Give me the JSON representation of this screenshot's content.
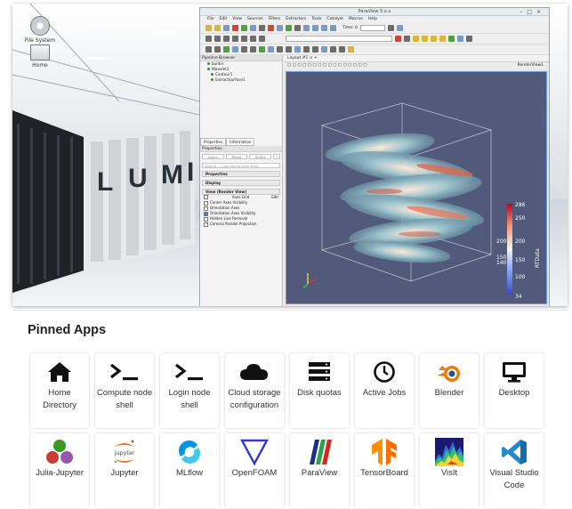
{
  "hero": {
    "desktop_icons": [
      {
        "label": "File System"
      },
      {
        "label": "Home"
      }
    ],
    "paraview": {
      "window_title": "ParaView 5.x.x",
      "menu": [
        "File",
        "Edit",
        "View",
        "Sources",
        "Filters",
        "Extractors",
        "Tools",
        "Catalyst",
        "Macros",
        "Help"
      ],
      "time_label": "Time: 0",
      "pipeline_header": "Pipeline Browser",
      "pipeline_items": [
        "builtin:",
        "Wavelet1",
        "Contour1",
        "ExtractSurface1"
      ],
      "tabs": [
        "Properties",
        "Information"
      ],
      "properties_header": "Properties",
      "buttons": [
        "Apply",
        "Reset",
        "Delete",
        "?"
      ],
      "search_placeholder": "Search ... (use Esc to clear text)",
      "sections": [
        "Properties",
        "Display",
        "View (Render View)"
      ],
      "axes_grid_label": "Axes Grid",
      "axes_grid_edit": "Edit",
      "options": [
        {
          "label": "Center Axes Visibility",
          "checked": false
        },
        {
          "label": "Orientation Axes",
          "checked": false
        },
        {
          "label": "Orientation Axes Visibility",
          "checked": true
        },
        {
          "label": "Hidden Line Removal",
          "checked": false
        },
        {
          "label": "Camera Parallel Projection",
          "checked": false
        }
      ],
      "layout_tab": "Layout #1",
      "view_name": "RenderView1",
      "colorbar": {
        "title": "RTData",
        "ticks": [
          "286",
          "250",
          "200",
          "150",
          "140",
          "100",
          "34"
        ],
        "gradient": [
          "#3b4cc0",
          "#8db0fe",
          "#f2f2f2",
          "#f49a7b",
          "#b40426"
        ]
      }
    }
  },
  "pinned_apps": {
    "title": "Pinned Apps",
    "apps": [
      {
        "label": "Home Directory",
        "icon": "home-icon"
      },
      {
        "label": "Compute node shell",
        "icon": "terminal-icon"
      },
      {
        "label": "Login node shell",
        "icon": "terminal-icon"
      },
      {
        "label": "Cloud storage configuration",
        "icon": "cloud-icon"
      },
      {
        "label": "Disk quotas",
        "icon": "server-icon"
      },
      {
        "label": "Active Jobs",
        "icon": "clock-icon"
      },
      {
        "label": "Blender",
        "icon": "blender-icon"
      },
      {
        "label": "Desktop",
        "icon": "monitor-icon"
      },
      {
        "label": "Julia-Jupyter",
        "icon": "julia-icon"
      },
      {
        "label": "Jupyter",
        "icon": "jupyter-icon"
      },
      {
        "label": "MLflow",
        "icon": "mlflow-icon"
      },
      {
        "label": "OpenFOAM",
        "icon": "openfoam-icon"
      },
      {
        "label": "ParaView",
        "icon": "paraview-icon"
      },
      {
        "label": "TensorBoard",
        "icon": "tensorboard-icon"
      },
      {
        "label": "VisIt",
        "icon": "visit-icon"
      },
      {
        "label": "Visual Studio Code",
        "icon": "vscode-icon"
      }
    ]
  },
  "colors": {
    "render_bg": "#515a7a",
    "selection_border": "#6d9be6",
    "blender_orange": "#e87d0d",
    "jupyter_orange": "#f37726",
    "mlflow_blue": "#0194e2",
    "openfoam_blue": "#2c3ad6",
    "tensorboard_orange": "#ff8f00",
    "vscode_blue": "#2489ca"
  }
}
